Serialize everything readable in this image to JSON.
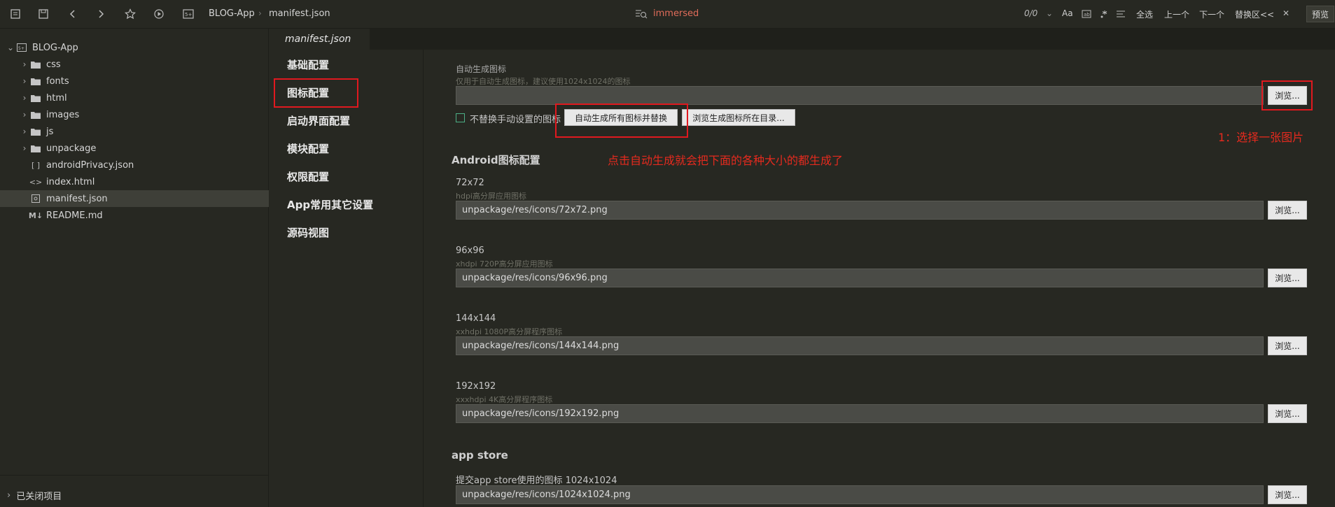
{
  "toolbar": {
    "breadcrumb_project": "BLOG-App",
    "breadcrumb_file": "manifest.json",
    "search_value": "immersed",
    "match_count": "0/0",
    "aa_label": "Aa",
    "select_all": "全选",
    "prev": "上一个",
    "next": "下一个",
    "replace_area": "替换区<<",
    "close": "✕",
    "preview": "预览"
  },
  "sidebar": {
    "project": "BLOG-App",
    "items": [
      {
        "label": "css"
      },
      {
        "label": "fonts"
      },
      {
        "label": "html"
      },
      {
        "label": "images"
      },
      {
        "label": "js"
      },
      {
        "label": "unpackage"
      },
      {
        "label": "androidPrivacy.json"
      },
      {
        "label": "index.html"
      },
      {
        "label": "manifest.json"
      },
      {
        "label": "README.md"
      }
    ],
    "closed_projects": "已关闭项目"
  },
  "tab": {
    "active": "manifest.json"
  },
  "settings_nav": [
    {
      "label": "基础配置"
    },
    {
      "label": "图标配置"
    },
    {
      "label": "启动界面配置"
    },
    {
      "label": "模块配置"
    },
    {
      "label": "权限配置"
    },
    {
      "label": "App常用其它设置"
    },
    {
      "label": "源码视图"
    }
  ],
  "content": {
    "auto_icon_label": "自动生成图标",
    "auto_icon_hint": "仅用于自动生成图标，建议使用1024x1024的图标",
    "auto_icon_value": "",
    "browse": "浏览...",
    "no_replace_checkbox": "不替换手动设置的图标",
    "no_replace_checked": false,
    "gen_all_button": "自动生成所有图标并替换",
    "browse_gen_dir_button": "浏览生成图标所在目录...",
    "android_section": "Android图标配置",
    "icons": [
      {
        "size": "72x72",
        "hint": "hdpi高分屏应用图标",
        "path": "unpackage/res/icons/72x72.png"
      },
      {
        "size": "96x96",
        "hint": "xhdpi 720P高分屏应用图标",
        "path": "unpackage/res/icons/96x96.png"
      },
      {
        "size": "144x144",
        "hint": "xxhdpi 1080P高分屏程序图标",
        "path": "unpackage/res/icons/144x144.png"
      },
      {
        "size": "192x192",
        "hint": "xxxhdpi 4K高分屏程序图标",
        "path": "unpackage/res/icons/192x192.png"
      }
    ],
    "appstore_section": "app store",
    "appstore_label": "提交app store使用的图标 1024x1024",
    "appstore_path": "unpackage/res/icons/1024x1024.png"
  },
  "annotations": {
    "step1": "1：选择一张图片",
    "auto_gen_note": "点击自动生成就会把下面的各种大小的都生成了"
  },
  "colors": {
    "background": "#272822",
    "annotation_red": "#e0191f",
    "search_text": "#e06c5a"
  }
}
